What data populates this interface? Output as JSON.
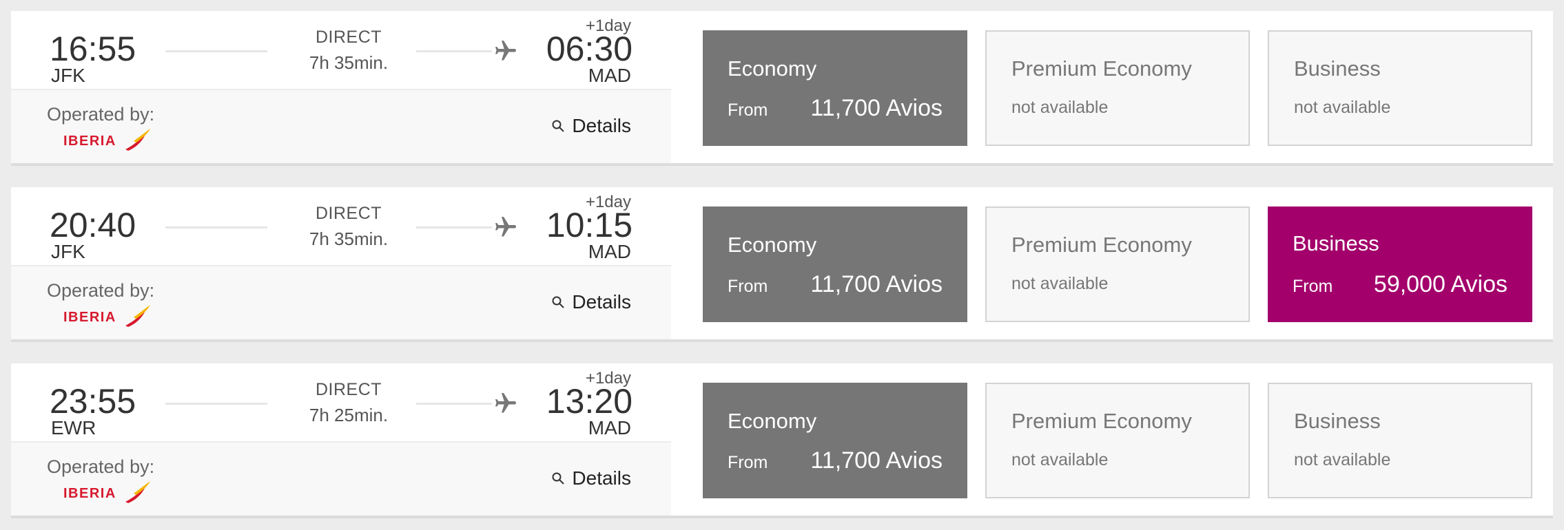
{
  "flights": [
    {
      "dep_time": "16:55",
      "dep_code": "JFK",
      "arr_time": "06:30",
      "arr_code": "MAD",
      "plus_day": "+1day",
      "stop": "DIRECT",
      "duration": "7h 35min.",
      "operated_label": "Operated by:",
      "airline": "IBERIA",
      "details_label": "Details",
      "fares": {
        "economy": {
          "name": "Economy",
          "from": "From",
          "price": "11,700 Avios"
        },
        "premium": {
          "name": "Premium Economy",
          "status": "not available"
        },
        "business": {
          "name": "Business",
          "status": "not available"
        }
      }
    },
    {
      "dep_time": "20:40",
      "dep_code": "JFK",
      "arr_time": "10:15",
      "arr_code": "MAD",
      "plus_day": "+1day",
      "stop": "DIRECT",
      "duration": "7h 35min.",
      "operated_label": "Operated by:",
      "airline": "IBERIA",
      "details_label": "Details",
      "fares": {
        "economy": {
          "name": "Economy",
          "from": "From",
          "price": "11,700 Avios"
        },
        "premium": {
          "name": "Premium Economy",
          "status": "not available"
        },
        "business": {
          "name": "Business",
          "from": "From",
          "price": "59,000 Avios"
        }
      }
    },
    {
      "dep_time": "23:55",
      "dep_code": "EWR",
      "arr_time": "13:20",
      "arr_code": "MAD",
      "plus_day": "+1day",
      "stop": "DIRECT",
      "duration": "7h 25min.",
      "operated_label": "Operated by:",
      "airline": "IBERIA",
      "details_label": "Details",
      "fares": {
        "economy": {
          "name": "Economy",
          "from": "From",
          "price": "11,700 Avios"
        },
        "premium": {
          "name": "Premium Economy",
          "status": "not available"
        },
        "business": {
          "name": "Business",
          "status": "not available"
        }
      }
    }
  ],
  "colors": {
    "economy_bg": "#767676",
    "business_active_bg": "#a3006b",
    "iberia_red": "#d7192d",
    "iberia_yellow": "#f5b400"
  }
}
